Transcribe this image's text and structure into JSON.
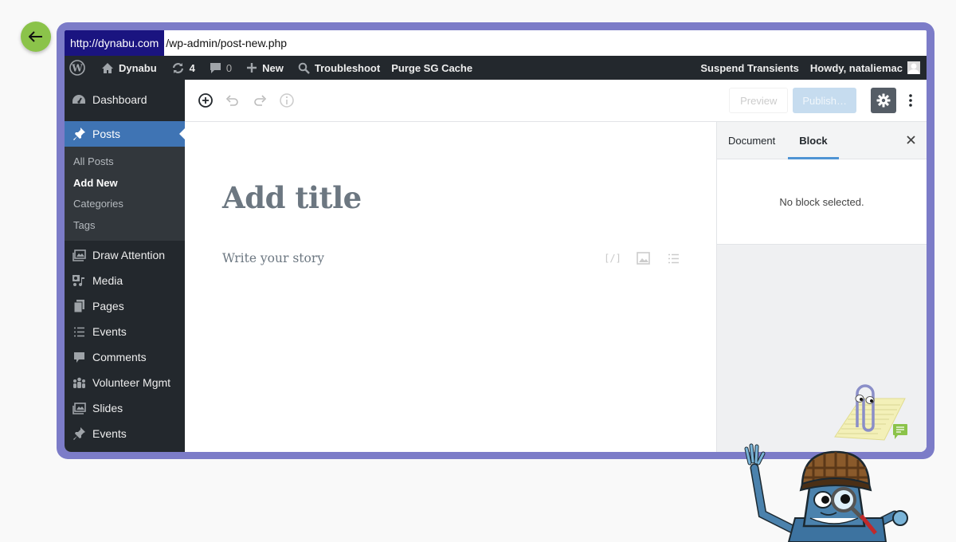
{
  "back_button": {
    "icon": "arrow-left-icon",
    "color": "#8bc34a"
  },
  "frame_color": "#7c7cc8",
  "url": {
    "host": "http://dynabu.com",
    "path": "/wp-admin/post-new.php"
  },
  "admin_bar": {
    "wp_logo": "wordpress-icon",
    "site_name": "Dynabu",
    "updates_count": "4",
    "comments_count": "0",
    "new_label": "New",
    "troubleshoot_label": "Troubleshoot",
    "purge_label": "Purge SG Cache",
    "suspend_label": "Suspend Transients",
    "howdy_label": "Howdy, nataliemac"
  },
  "sidebar": {
    "items": [
      {
        "label": "Dashboard",
        "icon": "dashboard-icon"
      },
      {
        "label": "Posts",
        "icon": "pin-icon",
        "active": true
      },
      {
        "label": "Draw Attention",
        "icon": "images-icon"
      },
      {
        "label": "Media",
        "icon": "media-icon"
      },
      {
        "label": "Pages",
        "icon": "pages-icon"
      },
      {
        "label": "Events",
        "icon": "list-icon"
      },
      {
        "label": "Comments",
        "icon": "comment-icon"
      },
      {
        "label": "Volunteer Mgmt",
        "icon": "groups-icon"
      },
      {
        "label": "Slides",
        "icon": "images-icon"
      },
      {
        "label": "Events",
        "icon": "pin-icon"
      }
    ],
    "submenu": [
      {
        "label": "All Posts"
      },
      {
        "label": "Add New",
        "current": true
      },
      {
        "label": "Categories"
      },
      {
        "label": "Tags"
      }
    ],
    "active_color": "#3f74b4"
  },
  "toolbar": {
    "preview_label": "Preview",
    "publish_label": "Publish…"
  },
  "editor": {
    "title_placeholder": "Add title",
    "body_placeholder": "Write your story"
  },
  "side_panel": {
    "tabs": [
      {
        "label": "Document"
      },
      {
        "label": "Block",
        "active": true
      }
    ],
    "empty_message": "No block selected."
  }
}
